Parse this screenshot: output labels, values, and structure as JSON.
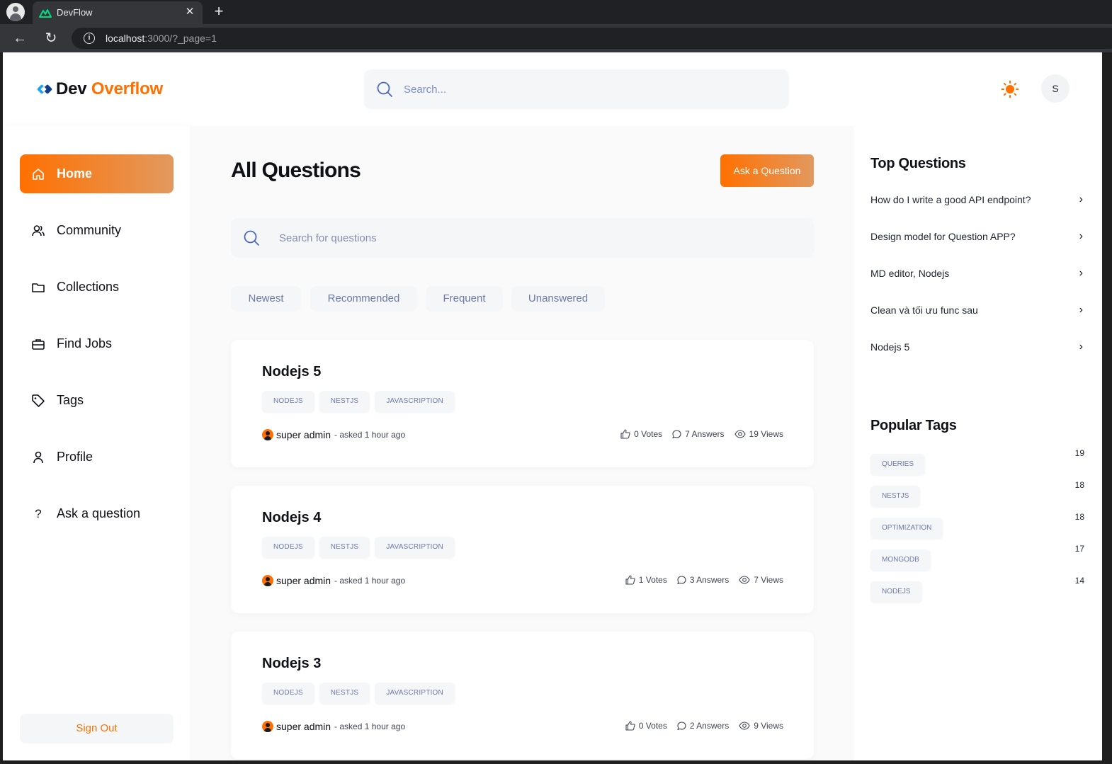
{
  "browser": {
    "tab_title": "DevFlow",
    "url_host": "localhost",
    "url_rest": ":3000/?_page=1"
  },
  "header": {
    "logo_first": "Dev",
    "logo_second": "Overflow",
    "search_placeholder": "Search...",
    "avatar_initial": "S"
  },
  "sidebar": {
    "items": [
      {
        "label": "Home",
        "icon": "home-icon",
        "active": true
      },
      {
        "label": "Community",
        "icon": "users-icon"
      },
      {
        "label": "Collections",
        "icon": "folder-icon"
      },
      {
        "label": "Find Jobs",
        "icon": "briefcase-icon"
      },
      {
        "label": "Tags",
        "icon": "tag-icon"
      },
      {
        "label": "Profile",
        "icon": "user-icon"
      },
      {
        "label": "Ask a question",
        "icon": "question-icon"
      }
    ],
    "sign_out": "Sign Out"
  },
  "main": {
    "title": "All Questions",
    "ask_button": "Ask a Question",
    "search_placeholder": "Search for questions",
    "filters": [
      "Newest",
      "Recommended",
      "Frequent",
      "Unanswered"
    ],
    "questions": [
      {
        "title": "Nodejs 5",
        "tags": [
          "NODEJS",
          "NESTJS",
          "JAVASCRIPTION"
        ],
        "author": "super admin",
        "asked": "- asked 1 hour ago",
        "votes": "0 Votes",
        "answers": "7 Answers",
        "views": "19 Views"
      },
      {
        "title": "Nodejs 4",
        "tags": [
          "NODEJS",
          "NESTJS",
          "JAVASCRIPTION"
        ],
        "author": "super admin",
        "asked": "- asked 1 hour ago",
        "votes": "1 Votes",
        "answers": "3 Answers",
        "views": "7 Views"
      },
      {
        "title": "Nodejs 3",
        "tags": [
          "NODEJS",
          "NESTJS",
          "JAVASCRIPTION"
        ],
        "author": "super admin",
        "asked": "- asked 1 hour ago",
        "votes": "0 Votes",
        "answers": "2 Answers",
        "views": "9 Views"
      }
    ]
  },
  "rightbar": {
    "top_questions_title": "Top Questions",
    "top_questions": [
      "How do I write a good API endpoint?",
      "Design model for Question APP?",
      "MD editor, Nodejs",
      "Clean và tối ưu func sau",
      "Nodejs 5"
    ],
    "popular_tags_title": "Popular Tags",
    "popular_tags": [
      {
        "name": "QUERIES",
        "count": "19"
      },
      {
        "name": "NESTJS",
        "count": "18"
      },
      {
        "name": "OPTIMIZATION",
        "count": "18"
      },
      {
        "name": "MONGODB",
        "count": "17"
      },
      {
        "name": "NODEJS",
        "count": "14"
      }
    ]
  },
  "colors": {
    "accent": "#ff7000",
    "accent_gradient_end": "#e2995f",
    "tag_text": "#6c7aa8",
    "surface": "#f4f6f8"
  }
}
